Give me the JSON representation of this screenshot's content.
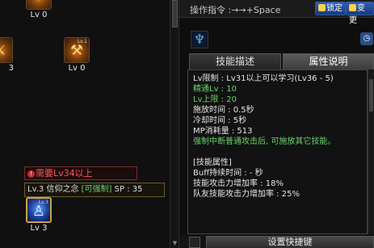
{
  "skills": [
    {
      "level_text": "Lv 0"
    },
    {
      "level_text": "3"
    },
    {
      "level_text": "Lv 0",
      "tag": "Lv.1"
    },
    {
      "level_text": "Lv 3",
      "tag": "Lv.3"
    }
  ],
  "requirement": {
    "icon": "!",
    "text": "需要Lv34以上"
  },
  "selected_skill": {
    "level_tag": "Lv.3",
    "name": "信仰之念",
    "force_tag": "[可强制]",
    "sp_label": "SP : 35"
  },
  "command": {
    "label": "操作指令 :→→+Space"
  },
  "buttons": {
    "lock": "锁定",
    "change": "变更",
    "shortcut": "设置快捷键"
  },
  "tabs": [
    {
      "label": "技能描述"
    },
    {
      "label": "属性说明"
    }
  ],
  "attributes": {
    "level_limit": "Lv限制 : Lv31以上可以学习(Lv36 - 5)",
    "master": "精通Lv : 10",
    "max": "Lv上限 : 20",
    "cast_time": "施放时间 : 0.5秒",
    "cooldown": "冷却时间 : 5秒",
    "mp": "MP消耗量 : 513",
    "force_desc": "强制中断普通攻击后, 可施放其它技能。",
    "section_title": "[技能属性]",
    "buff_duration": "Buff持续时间 : - 秒",
    "atk_bonus": "技能攻击力增加率 : 18%",
    "party_bonus": "队友技能攻击力增加率 : 25%"
  },
  "colors": {
    "accent_green": "#6ad26a",
    "warning_red": "#ff5a5a",
    "panel_blue": "#2e5fb3"
  }
}
